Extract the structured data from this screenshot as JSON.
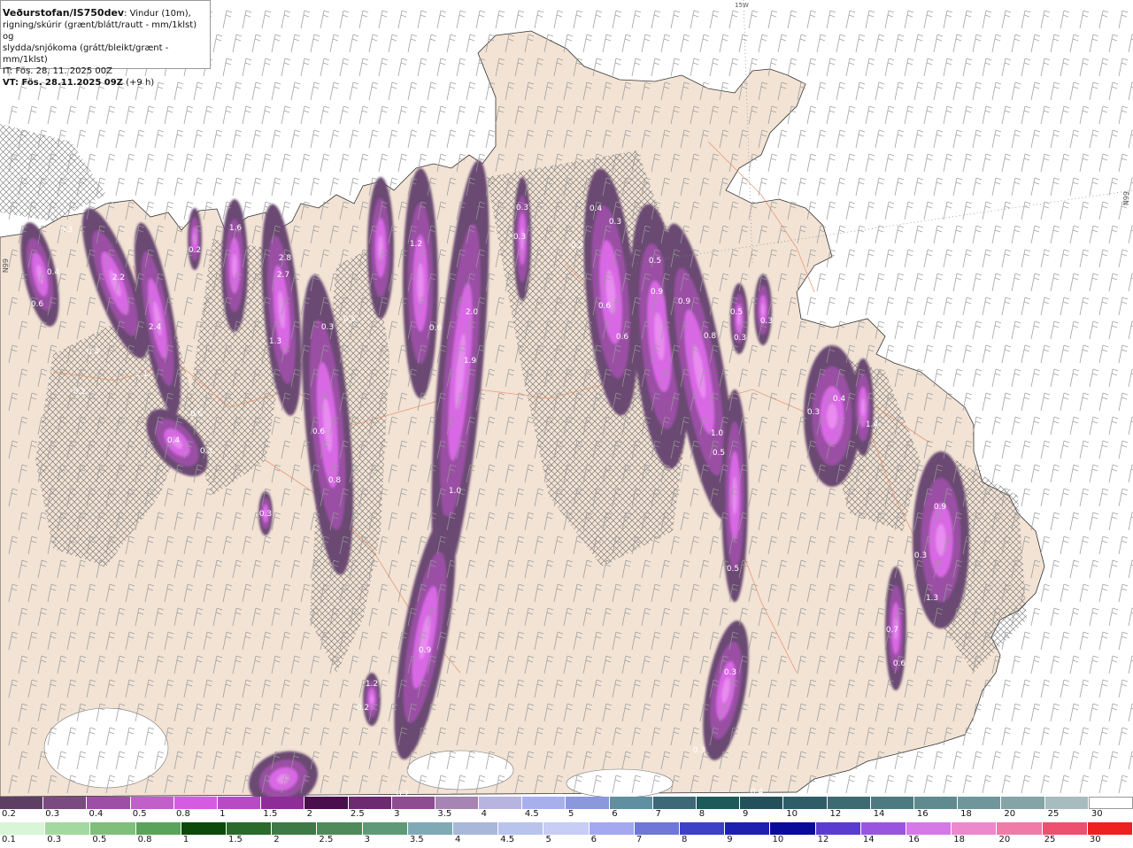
{
  "header": {
    "brand": "Veðurstofan/IS750dev",
    "desc_line1": ": Vindur (10m),",
    "desc_line2": "rigning/skúrir (grænt/blátt/rautt - mm/1klst) og",
    "desc_line3": "slydda/snjókoma (grátt/bleikt/grænt - mm/1klst)",
    "it": "IT: Fös. 28. 11. 2025 00Z",
    "vt": "VT: Fös. 28.11.2025 09Z",
    "vt_offset": " (+9 h)"
  },
  "map_labels": {
    "top_meridian": "15W",
    "left_parallel": "N99",
    "right_parallel": "N99"
  },
  "precip_labels": [
    "0.3",
    "0.4",
    "0.6",
    "2.2",
    "2.4",
    "0.4",
    "2.1",
    "0.2",
    "0.2",
    "0.6",
    "0.4",
    "0.3",
    "1.6",
    "2.8",
    "2.7",
    "1.3",
    "0.3",
    "0.6",
    "0.5",
    "0.8",
    "0.3",
    "1.2",
    "0.6",
    "2.0",
    "1.9",
    "0.6",
    "1.0",
    "0.9",
    "1.2",
    "0.2",
    "0.2",
    "0.3",
    "0.3",
    "0.4",
    "0.3",
    "0.6",
    "0.5",
    "0.9",
    "0.9",
    "0.8",
    "1.0",
    "0.5",
    "0.5",
    "0.3",
    "0.3",
    "0.3",
    "0.4",
    "1.4",
    "0.9",
    "0.3",
    "1.3",
    "0.7",
    "0.6",
    "0.5",
    "0.3",
    "0.3",
    "0.4",
    "0.2"
  ],
  "scale_top": {
    "ticks": [
      "0.2",
      "0.3",
      "0.4",
      "0.5",
      "0.8",
      "1",
      "1.5",
      "2",
      "2.5",
      "3",
      "3.5",
      "4",
      "4.5",
      "5",
      "6",
      "7",
      "8",
      "9",
      "10",
      "12",
      "14",
      "16",
      "18",
      "20",
      "25",
      "30"
    ],
    "colors": [
      "#5e3f64",
      "#7a4a80",
      "#9c4fa4",
      "#c060c8",
      "#d55ce0",
      "#b84ac4",
      "#8e2c98",
      "#4a0d4e",
      "#6c2a70",
      "#8d4d90",
      "#a684b3",
      "#b8b4e0",
      "#a8b0ec",
      "#8c98dc",
      "#5f8fa0",
      "#3d6878",
      "#1f5a5a",
      "#23505a",
      "#2e5d68",
      "#3d6b72",
      "#4d7a80",
      "#5f8a8e",
      "#6f979b",
      "#84a4a8",
      "#a6bcbf",
      "#ffffff"
    ]
  },
  "scale_bottom": {
    "ticks": [
      "0.1",
      "0.3",
      "0.5",
      "0.8",
      "1",
      "1.5",
      "2",
      "2.5",
      "3",
      "3.5",
      "4",
      "4.5",
      "5",
      "6",
      "7",
      "8",
      "9",
      "10",
      "12",
      "14",
      "16",
      "18",
      "20",
      "25",
      "30"
    ],
    "colors": [
      "#d8f5d8",
      "#a3d8a0",
      "#7fbf7a",
      "#5aa35a",
      "#0b4a0b",
      "#2a6a2a",
      "#3d7a45",
      "#4f8a5a",
      "#5f9a78",
      "#7faab5",
      "#a8b8d8",
      "#b8c4ec",
      "#c8cdf6",
      "#a3a8f0",
      "#7077d8",
      "#3e40c8",
      "#2020b0",
      "#0a0a9c",
      "#5a3cd0",
      "#9a55e0",
      "#d578e8",
      "#ee88cc",
      "#f07aa8",
      "#ee5070",
      "#ee2020"
    ]
  }
}
